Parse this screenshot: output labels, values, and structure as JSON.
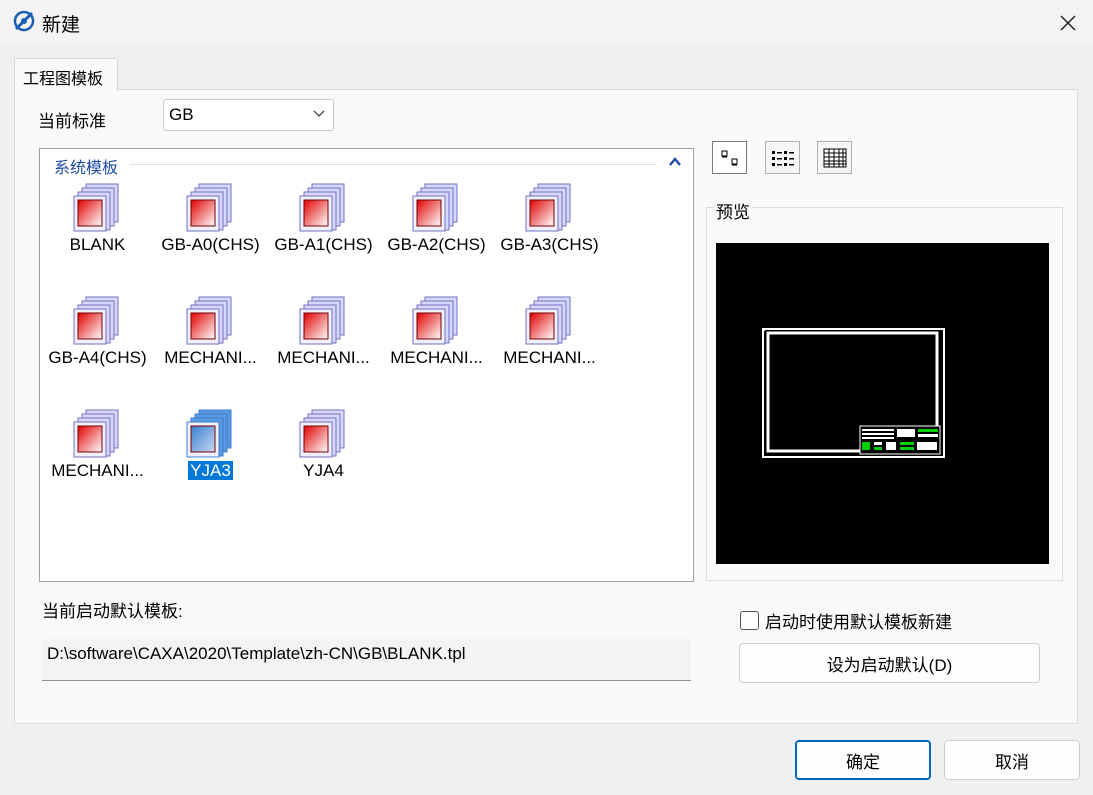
{
  "window": {
    "title": "新建",
    "close_glyph": "✕"
  },
  "tabs": [
    {
      "label": "工程图模板",
      "active": true
    }
  ],
  "standard": {
    "label": "当前标准",
    "selected": "GB"
  },
  "template_group": {
    "title": "系统模板",
    "collapse_glyph": "▲",
    "items": [
      {
        "label": "BLANK",
        "selected": false
      },
      {
        "label": "GB-A0(CHS)",
        "selected": false
      },
      {
        "label": "GB-A1(CHS)",
        "selected": false
      },
      {
        "label": "GB-A2(CHS)",
        "selected": false
      },
      {
        "label": "GB-A3(CHS)",
        "selected": false
      },
      {
        "label": "GB-A4(CHS)",
        "selected": false
      },
      {
        "label": "MECHANI...",
        "selected": false
      },
      {
        "label": "MECHANI...",
        "selected": false
      },
      {
        "label": "MECHANI...",
        "selected": false
      },
      {
        "label": "MECHANI...",
        "selected": false
      },
      {
        "label": "MECHANI...",
        "selected": false
      },
      {
        "label": "YJA3",
        "selected": true
      },
      {
        "label": "YJA4",
        "selected": false
      }
    ]
  },
  "view_modes": [
    {
      "icon": "large-icons-view-icon",
      "active": true
    },
    {
      "icon": "list-view-icon",
      "active": false
    },
    {
      "icon": "details-view-icon",
      "active": false
    }
  ],
  "preview": {
    "label": "预览"
  },
  "startup_default": {
    "label": "当前启动默认模板:",
    "path": "D:\\software\\CAXA\\2020\\Template\\zh-CN\\GB\\BLANK.tpl",
    "checkbox_label": "启动时使用默认模板新建",
    "checked": false,
    "set_button": "设为启动默认(D)"
  },
  "buttons": {
    "ok": "确定",
    "cancel": "取消"
  },
  "colors": {
    "selection": "#0078d7",
    "group_title": "#1f4aa8",
    "preview_bg": "#000000",
    "title_block_green": "#00d000"
  }
}
